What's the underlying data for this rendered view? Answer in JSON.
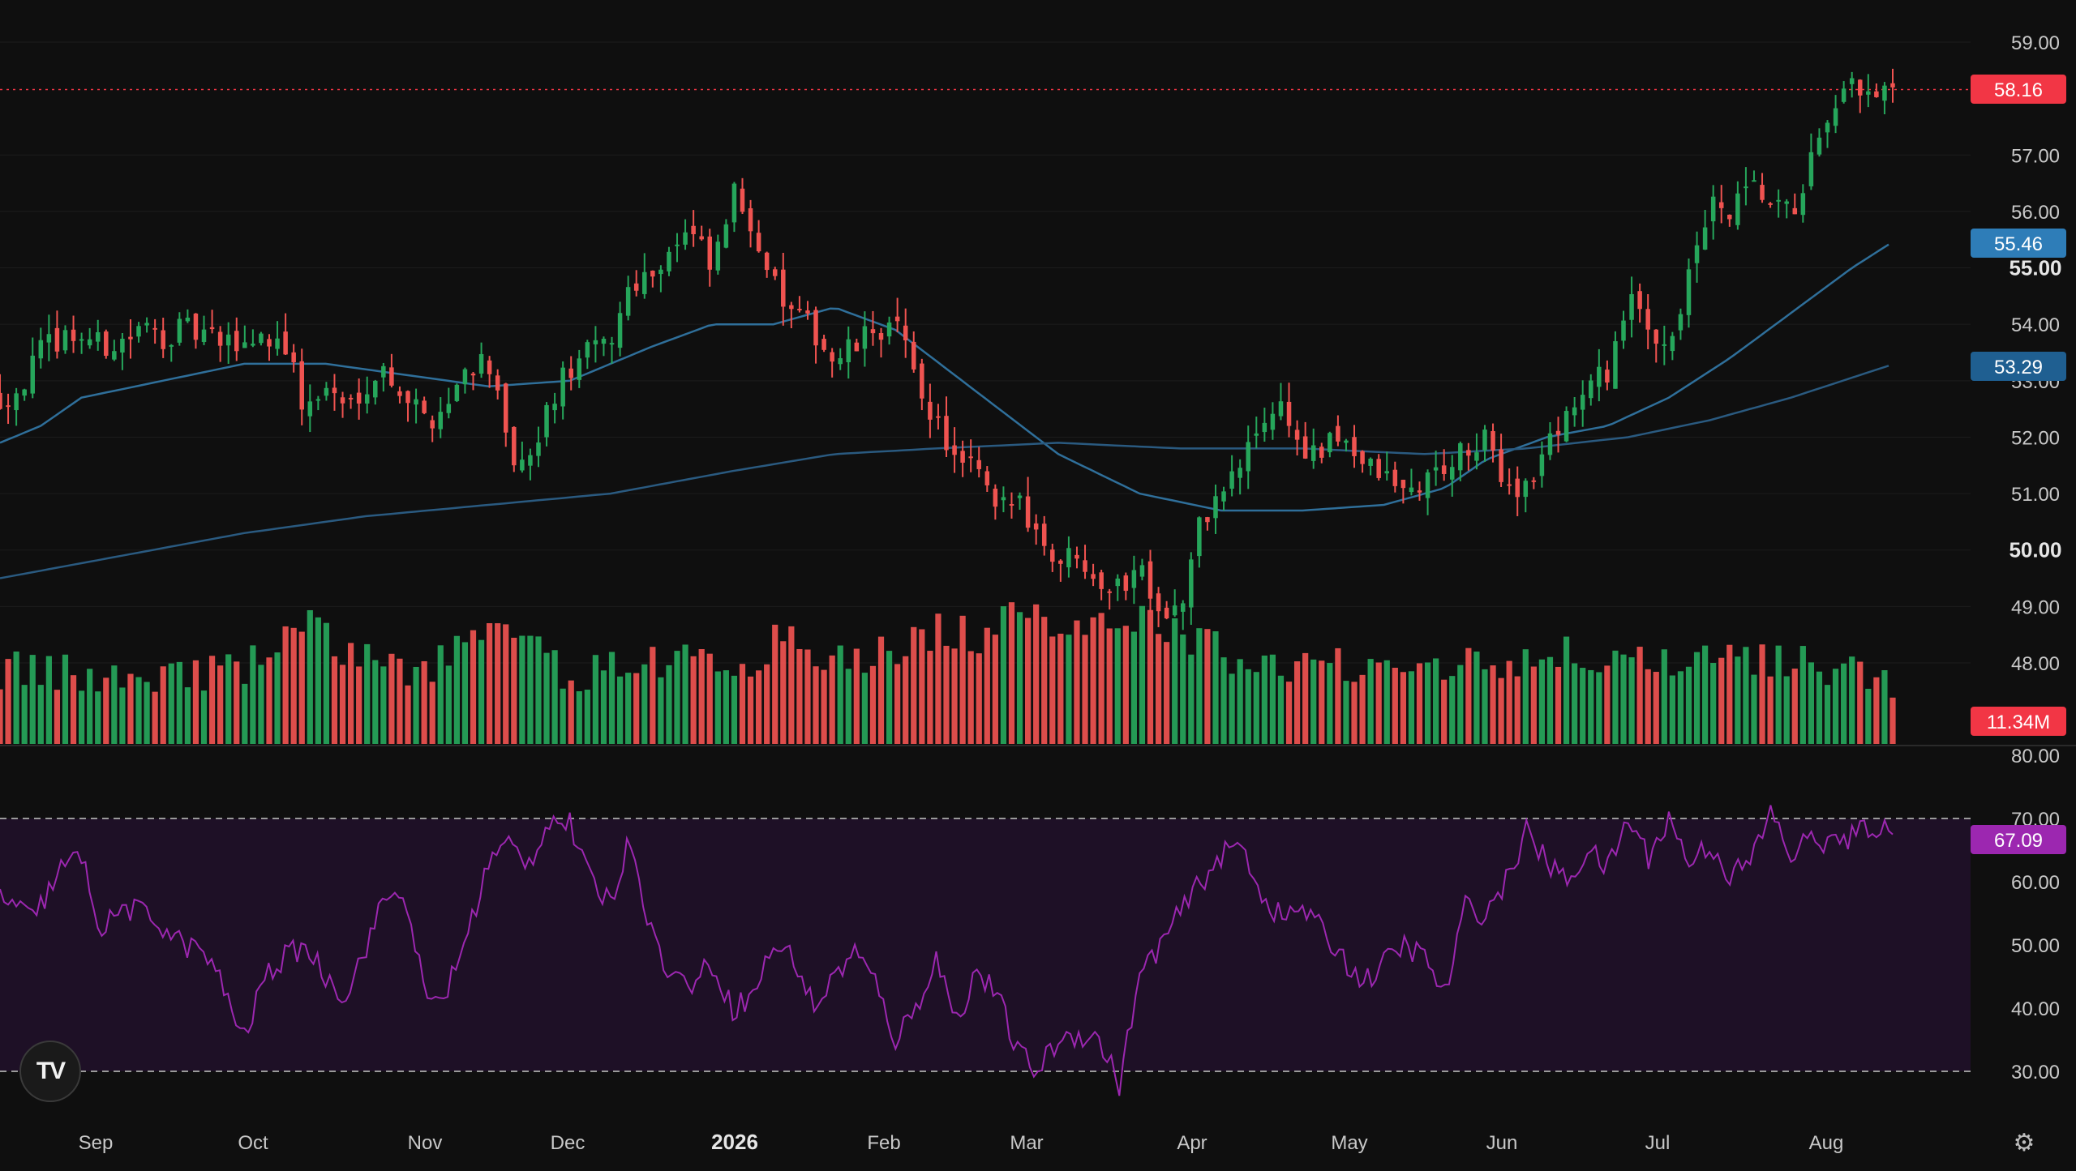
{
  "app": {
    "logo_text": "TV"
  },
  "colors": {
    "up": "#26a65b",
    "down": "#ef5350",
    "ma_fast": "#2f6f9a",
    "ma_slow": "#2a5a80",
    "rsi_line": "#9c27b0",
    "rsi_band": "#1e1026",
    "rsi_tag": "#9c27b0",
    "price_tag": "#f23645",
    "ma_fast_tag": "#2e7db8",
    "ma_slow_tag": "#1f5f91",
    "volume_tag": "#f23645"
  },
  "icons": {
    "settings": "gear-icon",
    "logo": "tradingview-logo"
  },
  "tags": {
    "last_price": "58.16",
    "ma_fast": "55.46",
    "ma_slow": "53.29",
    "volume": "11.34M",
    "rsi": "67.09"
  },
  "price_axis": {
    "ticks": [
      "59.00",
      "57.00",
      "56.00",
      "55.00",
      "54.00",
      "53.00",
      "52.00",
      "51.00",
      "50.00",
      "49.00",
      "48.00"
    ],
    "values": [
      59,
      57,
      56,
      55,
      54,
      53,
      52,
      51,
      50,
      49,
      48
    ],
    "bold": [
      "55.00",
      "50.00"
    ]
  },
  "rsi_axis": {
    "ticks": [
      "80.00",
      "70.00",
      "60.00",
      "50.00",
      "40.00",
      "30.00"
    ],
    "values": [
      80,
      70,
      60,
      50,
      40,
      30
    ]
  },
  "time_axis": {
    "labels": [
      "Sep",
      "Oct",
      "Nov",
      "Dec",
      "2026",
      "Feb",
      "Mar",
      "Apr",
      "May",
      "Jun",
      "Jul",
      "Aug"
    ],
    "bold": [
      "2026"
    ]
  },
  "chart_data": {
    "type": "candlestick",
    "title": "",
    "date_range": [
      "2025-08-25",
      "2026-08-14"
    ],
    "price_range": [
      47.3,
      59.6
    ],
    "last_close": 58.16,
    "moving_averages": [
      {
        "value_at_end": 55.46,
        "path": [
          [
            0,
            51.9
          ],
          [
            10,
            52.2
          ],
          [
            20,
            52.7
          ],
          [
            40,
            53.0
          ],
          [
            60,
            53.3
          ],
          [
            80,
            53.3
          ],
          [
            100,
            53.1
          ],
          [
            120,
            52.9
          ],
          [
            140,
            53.0
          ],
          [
            160,
            53.6
          ],
          [
            175,
            54.0
          ],
          [
            190,
            54.0
          ],
          [
            205,
            54.3
          ],
          [
            220,
            53.9
          ],
          [
            240,
            52.8
          ],
          [
            260,
            51.7
          ],
          [
            280,
            51.0
          ],
          [
            300,
            50.7
          ],
          [
            320,
            50.7
          ],
          [
            340,
            50.8
          ],
          [
            355,
            51.1
          ],
          [
            365,
            51.6
          ],
          [
            380,
            52.0
          ],
          [
            395,
            52.2
          ],
          [
            410,
            52.7
          ],
          [
            425,
            53.4
          ],
          [
            440,
            54.2
          ],
          [
            455,
            55.0
          ],
          [
            465,
            55.46
          ]
        ]
      },
      {
        "value_at_end": 53.29,
        "path": [
          [
            0,
            49.5
          ],
          [
            30,
            49.9
          ],
          [
            60,
            50.3
          ],
          [
            90,
            50.6
          ],
          [
            120,
            50.8
          ],
          [
            150,
            51.0
          ],
          [
            180,
            51.4
          ],
          [
            205,
            51.7
          ],
          [
            230,
            51.8
          ],
          [
            260,
            51.9
          ],
          [
            290,
            51.8
          ],
          [
            320,
            51.8
          ],
          [
            350,
            51.7
          ],
          [
            375,
            51.8
          ],
          [
            400,
            52.0
          ],
          [
            420,
            52.3
          ],
          [
            440,
            52.7
          ],
          [
            465,
            53.29
          ]
        ]
      }
    ],
    "price_path": [
      [
        0,
        52.7
      ],
      [
        5,
        52.9
      ],
      [
        10,
        53.5
      ],
      [
        15,
        53.8
      ],
      [
        20,
        53.8
      ],
      [
        25,
        53.6
      ],
      [
        30,
        53.7
      ],
      [
        35,
        53.9
      ],
      [
        40,
        53.8
      ],
      [
        45,
        53.9
      ],
      [
        50,
        53.8
      ],
      [
        55,
        53.6
      ],
      [
        60,
        53.7
      ],
      [
        65,
        53.8
      ],
      [
        70,
        53.7
      ],
      [
        75,
        52.4
      ],
      [
        80,
        52.9
      ],
      [
        85,
        52.5
      ],
      [
        90,
        53.0
      ],
      [
        95,
        53.2
      ],
      [
        100,
        52.7
      ],
      [
        105,
        52.3
      ],
      [
        110,
        52.6
      ],
      [
        115,
        53.3
      ],
      [
        120,
        53.4
      ],
      [
        125,
        51.6
      ],
      [
        130,
        51.4
      ],
      [
        135,
        52.6
      ],
      [
        140,
        53.2
      ],
      [
        145,
        53.5
      ],
      [
        150,
        53.7
      ],
      [
        155,
        54.8
      ],
      [
        160,
        54.9
      ],
      [
        165,
        55.4
      ],
      [
        170,
        55.6
      ],
      [
        175,
        54.9
      ],
      [
        180,
        56.3
      ],
      [
        185,
        55.8
      ],
      [
        190,
        54.7
      ],
      [
        195,
        54.1
      ],
      [
        200,
        53.9
      ],
      [
        205,
        53.3
      ],
      [
        210,
        53.6
      ],
      [
        215,
        53.9
      ],
      [
        220,
        54.0
      ],
      [
        225,
        53.0
      ],
      [
        230,
        52.3
      ],
      [
        235,
        51.5
      ],
      [
        240,
        51.4
      ],
      [
        245,
        50.6
      ],
      [
        250,
        51.0
      ],
      [
        255,
        50.3
      ],
      [
        260,
        49.8
      ],
      [
        265,
        50.0
      ],
      [
        270,
        49.5
      ],
      [
        275,
        49.3
      ],
      [
        280,
        49.8
      ],
      [
        285,
        49.0
      ],
      [
        290,
        48.9
      ],
      [
        295,
        50.5
      ],
      [
        300,
        51.0
      ],
      [
        305,
        51.5
      ],
      [
        310,
        52.3
      ],
      [
        315,
        52.6
      ],
      [
        320,
        51.7
      ],
      [
        325,
        51.7
      ],
      [
        330,
        52.1
      ],
      [
        335,
        51.5
      ],
      [
        340,
        51.3
      ],
      [
        345,
        51.0
      ],
      [
        350,
        51.2
      ],
      [
        355,
        51.5
      ],
      [
        360,
        51.7
      ],
      [
        365,
        51.9
      ],
      [
        370,
        51.2
      ],
      [
        375,
        51.1
      ],
      [
        380,
        51.8
      ],
      [
        385,
        52.5
      ],
      [
        390,
        52.8
      ],
      [
        395,
        53.2
      ],
      [
        400,
        54.4
      ],
      [
        405,
        53.9
      ],
      [
        410,
        53.7
      ],
      [
        415,
        54.8
      ],
      [
        420,
        56.1
      ],
      [
        425,
        55.9
      ],
      [
        430,
        56.4
      ],
      [
        435,
        56.1
      ],
      [
        440,
        55.9
      ],
      [
        445,
        56.9
      ],
      [
        450,
        57.5
      ],
      [
        455,
        58.3
      ],
      [
        460,
        57.9
      ],
      [
        465,
        58.16
      ]
    ],
    "volume_path": [
      [
        0,
        0.45
      ],
      [
        20,
        0.4
      ],
      [
        40,
        0.42
      ],
      [
        60,
        0.45
      ],
      [
        75,
        0.85
      ],
      [
        80,
        0.7
      ],
      [
        100,
        0.4
      ],
      [
        120,
        0.75
      ],
      [
        125,
        0.75
      ],
      [
        140,
        0.4
      ],
      [
        160,
        0.55
      ],
      [
        180,
        0.48
      ],
      [
        195,
        0.75
      ],
      [
        200,
        0.5
      ],
      [
        220,
        0.6
      ],
      [
        230,
        0.8
      ],
      [
        240,
        0.72
      ],
      [
        250,
        0.88
      ],
      [
        260,
        0.85
      ],
      [
        270,
        0.9
      ],
      [
        280,
        0.88
      ],
      [
        290,
        0.75
      ],
      [
        300,
        0.6
      ],
      [
        320,
        0.45
      ],
      [
        340,
        0.55
      ],
      [
        360,
        0.5
      ],
      [
        380,
        0.58
      ],
      [
        395,
        0.55
      ],
      [
        410,
        0.45
      ],
      [
        420,
        0.5
      ],
      [
        440,
        0.55
      ],
      [
        460,
        0.4
      ],
      [
        465,
        0.2
      ]
    ],
    "rsi": {
      "levels": {
        "upper": 70,
        "lower": 30
      },
      "path": [
        [
          0,
          58
        ],
        [
          8,
          54
        ],
        [
          15,
          62
        ],
        [
          20,
          64
        ],
        [
          25,
          52
        ],
        [
          30,
          56
        ],
        [
          35,
          55
        ],
        [
          40,
          53
        ],
        [
          45,
          50
        ],
        [
          50,
          49
        ],
        [
          55,
          43
        ],
        [
          60,
          35
        ],
        [
          65,
          45
        ],
        [
          70,
          48
        ],
        [
          75,
          50
        ],
        [
          80,
          45
        ],
        [
          85,
          42
        ],
        [
          90,
          50
        ],
        [
          95,
          58
        ],
        [
          100,
          57
        ],
        [
          105,
          40
        ],
        [
          110,
          43
        ],
        [
          115,
          52
        ],
        [
          120,
          63
        ],
        [
          125,
          66
        ],
        [
          130,
          63
        ],
        [
          135,
          70
        ],
        [
          140,
          69
        ],
        [
          145,
          60
        ],
        [
          150,
          57
        ],
        [
          155,
          67
        ],
        [
          160,
          52
        ],
        [
          165,
          45
        ],
        [
          170,
          44
        ],
        [
          175,
          47
        ],
        [
          180,
          40
        ],
        [
          185,
          42
        ],
        [
          190,
          50
        ],
        [
          195,
          48
        ],
        [
          200,
          40
        ],
        [
          205,
          45
        ],
        [
          210,
          49
        ],
        [
          215,
          44
        ],
        [
          220,
          35
        ],
        [
          225,
          40
        ],
        [
          230,
          48
        ],
        [
          235,
          38
        ],
        [
          240,
          46
        ],
        [
          245,
          42
        ],
        [
          250,
          33
        ],
        [
          255,
          30
        ],
        [
          260,
          35
        ],
        [
          265,
          36
        ],
        [
          270,
          35
        ],
        [
          275,
          28
        ],
        [
          280,
          45
        ],
        [
          285,
          50
        ],
        [
          290,
          55
        ],
        [
          295,
          60
        ],
        [
          300,
          64
        ],
        [
          305,
          66
        ],
        [
          310,
          58
        ],
        [
          315,
          54
        ],
        [
          320,
          56
        ],
        [
          325,
          52
        ],
        [
          330,
          48
        ],
        [
          335,
          44
        ],
        [
          340,
          47
        ],
        [
          345,
          50
        ],
        [
          350,
          48
        ],
        [
          355,
          42
        ],
        [
          360,
          56
        ],
        [
          365,
          55
        ],
        [
          370,
          60
        ],
        [
          375,
          68
        ],
        [
          380,
          63
        ],
        [
          385,
          60
        ],
        [
          390,
          65
        ],
        [
          395,
          62
        ],
        [
          400,
          70
        ],
        [
          405,
          64
        ],
        [
          410,
          70
        ],
        [
          415,
          63
        ],
        [
          420,
          66
        ],
        [
          425,
          61
        ],
        [
          430,
          63
        ],
        [
          435,
          71
        ],
        [
          440,
          64
        ],
        [
          445,
          67
        ],
        [
          450,
          66
        ],
        [
          455,
          67
        ],
        [
          460,
          69
        ],
        [
          465,
          67.09
        ]
      ]
    }
  }
}
